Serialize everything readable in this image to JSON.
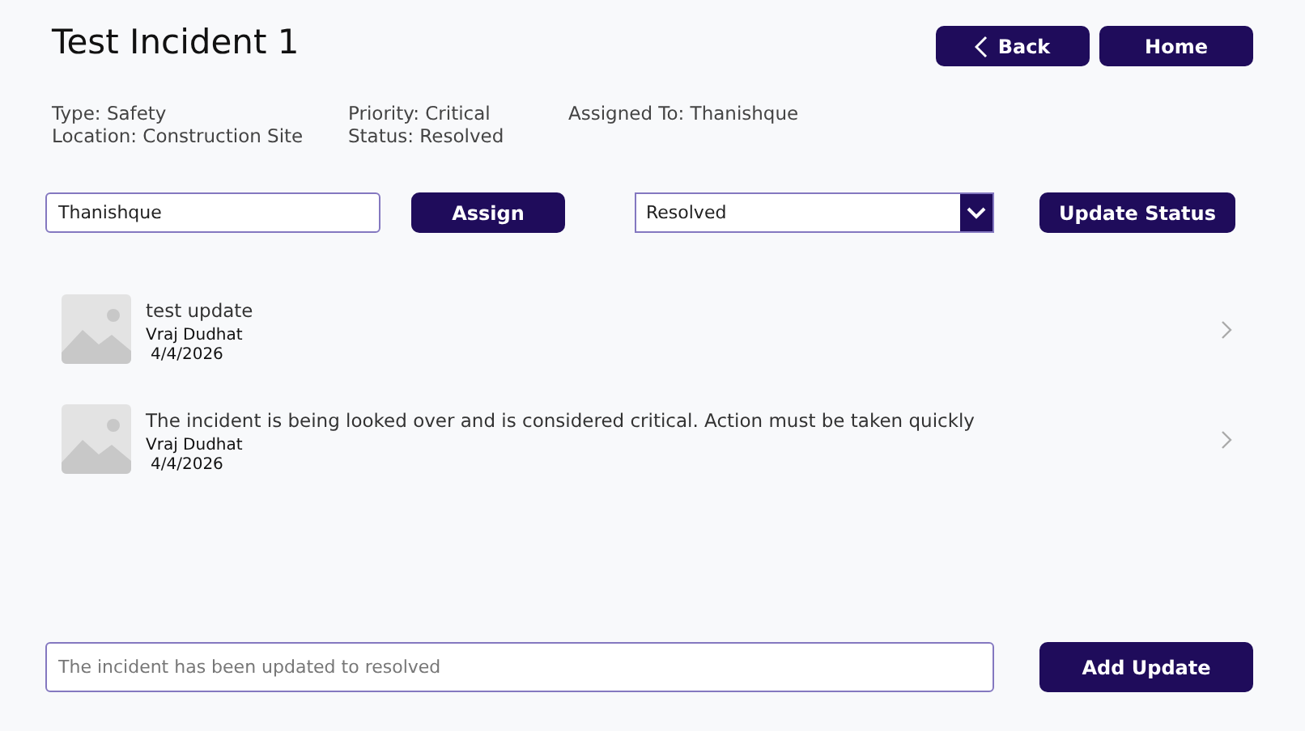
{
  "title": "Test Incident 1",
  "nav_buttons": [
    {
      "label": "Back",
      "kind": "back"
    },
    {
      "label": "Home",
      "kind": "plain"
    }
  ],
  "details": [
    [
      "Type: Safety",
      "Location: Construction Site"
    ],
    [
      "Priority: Critical",
      "Status: Resolved"
    ],
    [
      "Assigned To: Thanishque"
    ]
  ],
  "assign": {
    "value": "Thanishque",
    "button": "Assign"
  },
  "status": {
    "value": "Resolved",
    "button": "Update Status"
  },
  "updates": [
    {
      "text": "test update",
      "author": "Vraj Dudhat",
      "date": "4/4/2026"
    },
    {
      "text": "The incident is being looked over and is considered critical. Action must be taken quickly",
      "author": "Vraj Dudhat",
      "date": "4/4/2026"
    }
  ],
  "new_update": {
    "placeholder": "The incident has been updated to resolved",
    "button": "Add Update"
  }
}
